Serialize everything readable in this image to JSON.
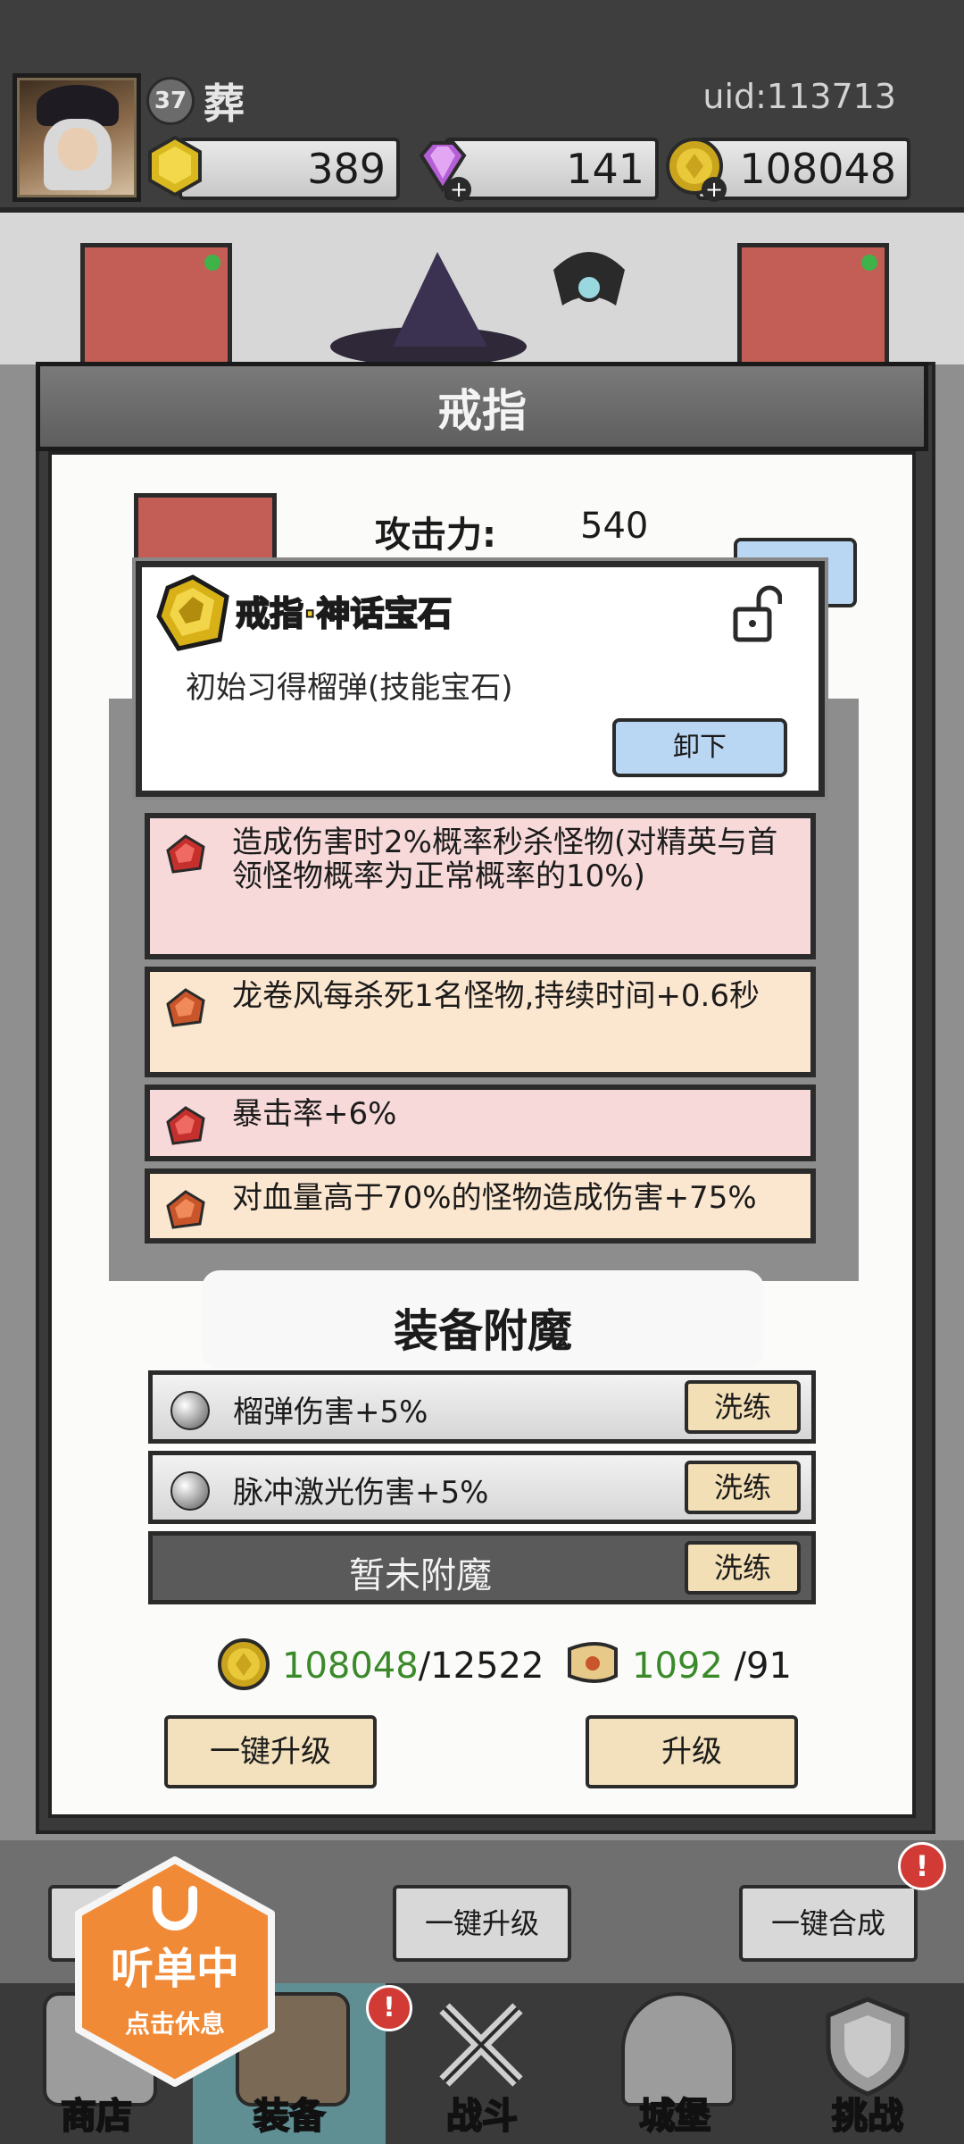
{
  "header": {
    "level": "37",
    "name": "葬",
    "uid": "uid:113713",
    "resources": [
      {
        "icon": "gold-hexagon-icon",
        "value": "389"
      },
      {
        "icon": "purple-diamond-icon",
        "value": "141"
      },
      {
        "icon": "gold-coin-icon",
        "value": "108048"
      }
    ]
  },
  "dialog": {
    "title": "戒指",
    "attack_label": "攻击力:",
    "attack_value": "540"
  },
  "gem_popup": {
    "title": "戒指·神话宝石",
    "description": "初始习得榴弹(技能宝石)",
    "unequip_label": "卸下"
  },
  "affixes": [
    {
      "text": "造成伤害时2%概率秒杀怪物(对精英与首领怪物概率为正常概率的10%)",
      "color": "#f7d9d9"
    },
    {
      "text": "龙卷风每杀死1名怪物,持续时间+0.6秒",
      "color": "#fbe6cf"
    },
    {
      "text": "暴击率+6%",
      "color": "#f7d9d9"
    },
    {
      "text": "对血量高于70%的怪物造成伤害+75%",
      "color": "#fbe6cf"
    }
  ],
  "enchant": {
    "title": "装备附魔",
    "rows": [
      {
        "text": "榴弹伤害+5%",
        "button": "洗练"
      },
      {
        "text": "脉冲激光伤害+5%",
        "button": "洗练"
      },
      {
        "text": "暂未附魔",
        "button": "洗练"
      }
    ],
    "gold_have": "108048",
    "gold_need": "/12522",
    "scroll_have": "1092",
    "scroll_need": " /91",
    "one_click_upgrade": "一键升级",
    "upgrade": "升级"
  },
  "bottom_buttons": {
    "one_click_upgrade": "一键升级",
    "one_click_merge": "一键合成",
    "alert": "!"
  },
  "nav": [
    {
      "label": "商店"
    },
    {
      "label": "装备"
    },
    {
      "label": "战斗"
    },
    {
      "label": "城堡"
    },
    {
      "label": "挑战"
    }
  ],
  "floating_widget": {
    "title": "听单中",
    "subtitle": "点击休息"
  }
}
